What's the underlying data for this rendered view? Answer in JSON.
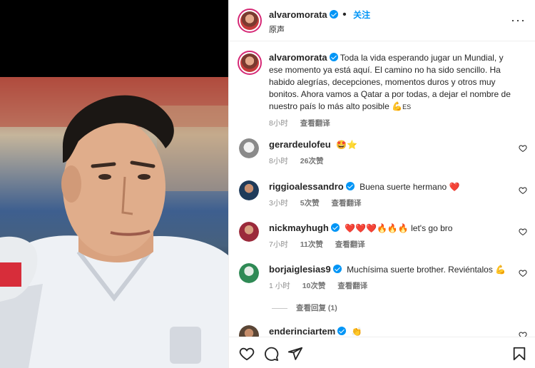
{
  "post": {
    "author": "alvaromorata",
    "follow_label": "关注",
    "audio_label": "原声",
    "more_label": "···"
  },
  "caption": {
    "username": "alvaromorata",
    "text": "Toda la vida esperando jugar un Mundial, y ese momento ya está aquí. El camino no ha sido sencillo. Ha habido alegrías, decepciones, momentos duros y otros muy bonitos. Ahora vamos a Qatar a por todas, a dejar el nombre de nuestro país lo más alto posible ",
    "emoji": "💪",
    "suffix": "ES",
    "time": "8小时",
    "translate": "查看翻译"
  },
  "comments": [
    {
      "username": "gerardeulofeu",
      "verified": false,
      "text": "🤩⭐",
      "time": "8小时",
      "likes": "26次赞",
      "translate": ""
    },
    {
      "username": "riggioalessandro",
      "verified": true,
      "text": "Buena suerte hermano ❤️",
      "time": "3小时",
      "likes": "5次赞",
      "translate": "查看翻译"
    },
    {
      "username": "nickmayhugh",
      "verified": true,
      "text": "❤️❤️❤️🔥🔥🔥 let's go bro",
      "time": "7小时",
      "likes": "11次赞",
      "translate": "查看翻译"
    },
    {
      "username": "borjaiglesias9",
      "verified": true,
      "text": "Muchísima suerte brother. Reviéntalos 💪",
      "time": "1 小时",
      "likes": "10次赞",
      "translate": "查看翻译"
    },
    {
      "username": "enderinciartem",
      "verified": true,
      "text": "👏",
      "time": "",
      "likes": "",
      "translate": ""
    }
  ],
  "view_replies": "查看回复 (1)",
  "icons": {
    "like": "heart-icon",
    "comment": "comment-icon",
    "share": "paper-plane-icon",
    "save": "bookmark-icon",
    "more": "more-horizontal-icon"
  }
}
